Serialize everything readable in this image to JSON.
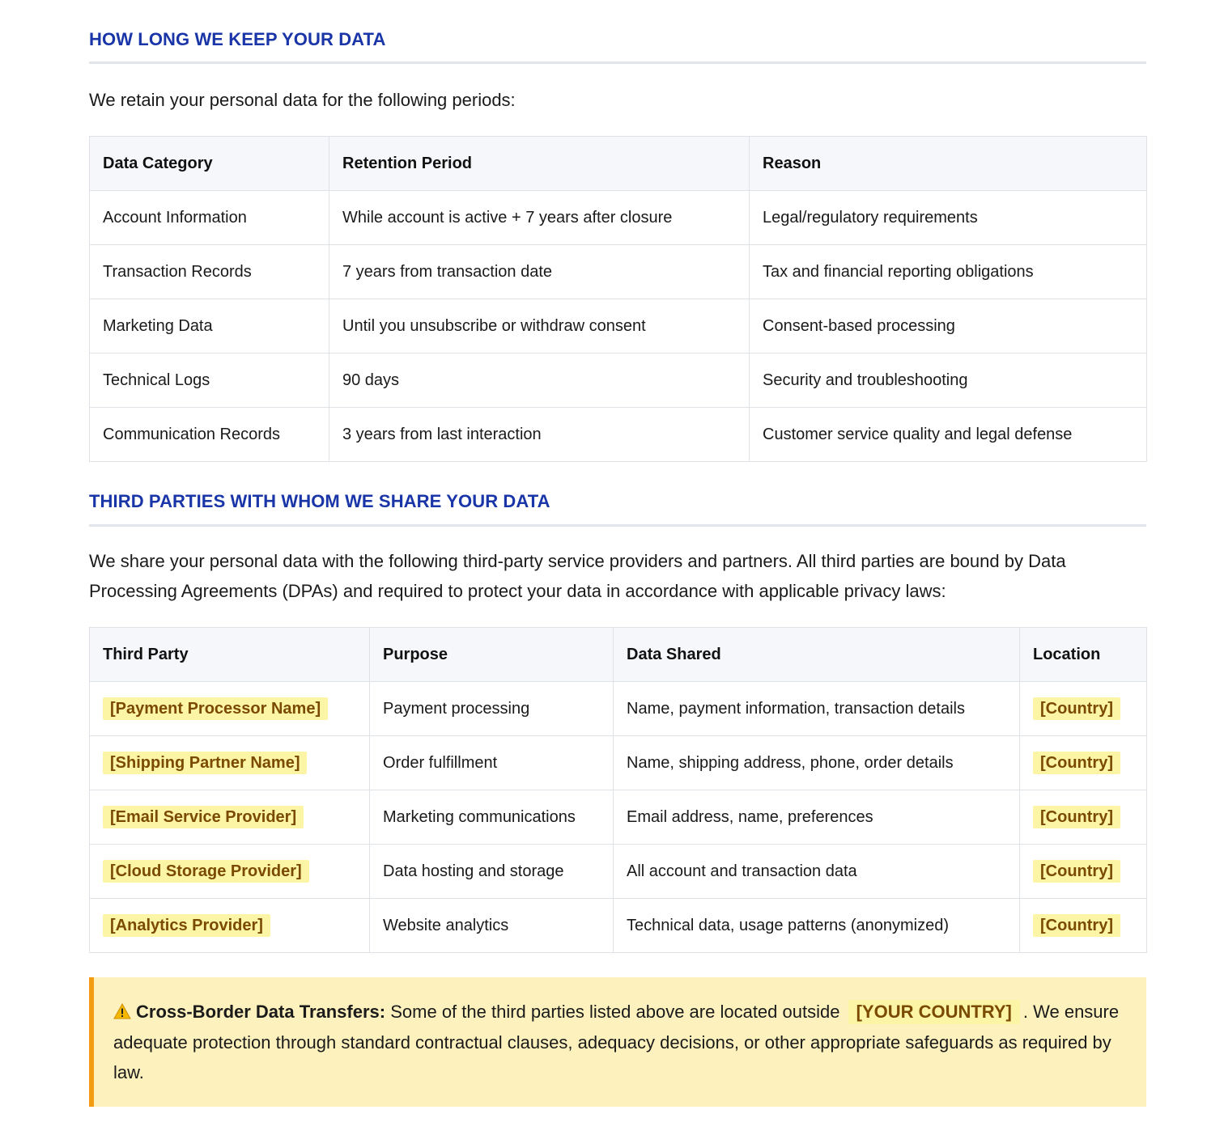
{
  "retention": {
    "title": "HOW LONG WE KEEP YOUR DATA",
    "intro": "We retain your personal data for the following periods:",
    "headers": [
      "Data Category",
      "Retention Period",
      "Reason"
    ],
    "rows": [
      [
        "Account Information",
        "While account is active + 7 years after closure",
        "Legal/regulatory requirements"
      ],
      [
        "Transaction Records",
        "7 years from transaction date",
        "Tax and financial reporting obligations"
      ],
      [
        "Marketing Data",
        "Until you unsubscribe or withdraw consent",
        "Consent-based processing"
      ],
      [
        "Technical Logs",
        "90 days",
        "Security and troubleshooting"
      ],
      [
        "Communication Records",
        "3 years from last interaction",
        "Customer service quality and legal defense"
      ]
    ]
  },
  "third_parties": {
    "title": "THIRD PARTIES WITH WHOM WE SHARE YOUR DATA",
    "intro": "We share your personal data with the following third-party service providers and partners. All third parties are bound by Data Processing Agreements (DPAs) and required to protect your data in accordance with applicable privacy laws:",
    "headers": [
      "Third Party",
      "Purpose",
      "Data Shared",
      "Location"
    ],
    "rows": [
      [
        "[Payment Processor Name]",
        "Payment processing",
        "Name, payment information, transaction details",
        "[Country]"
      ],
      [
        "[Shipping Partner Name]",
        "Order fulfillment",
        "Name, shipping address, phone, order details",
        "[Country]"
      ],
      [
        "[Email Service Provider]",
        "Marketing communications",
        "Email address, name, preferences",
        "[Country]"
      ],
      [
        "[Cloud Storage Provider]",
        "Data hosting and storage",
        "All account and transaction data",
        "[Country]"
      ],
      [
        "[Analytics Provider]",
        "Website analytics",
        "Technical data, usage patterns (anonymized)",
        "[Country]"
      ]
    ]
  },
  "callout": {
    "icon": "warning-icon",
    "lead": "Cross-Border Data Transfers:",
    "text_before": "Some of the third parties listed above are located outside",
    "placeholder": "[YOUR COUNTRY]",
    "text_after": ". We ensure adequate protection through standard contractual clauses, adequacy decisions, or other appropriate safeguards as required by law."
  },
  "colors": {
    "heading": "#1a35a8",
    "placeholder_bg": "#fdf5a6",
    "placeholder_text": "#7a4a00",
    "callout_bg": "#fdf1bd",
    "callout_border": "#f39c12"
  }
}
